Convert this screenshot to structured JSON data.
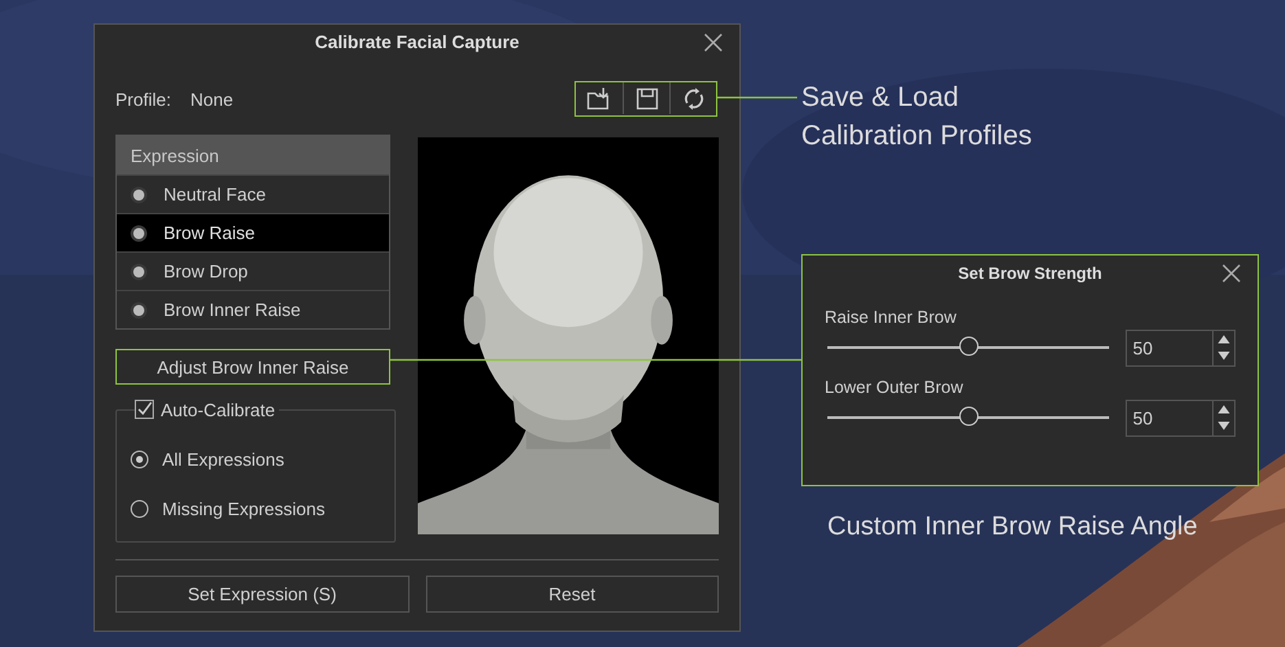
{
  "dialog": {
    "title": "Calibrate Facial Capture",
    "profile_label": "Profile:",
    "profile_value": "None",
    "expression_list": {
      "header": "Expression",
      "items": [
        {
          "label": "Neutral Face",
          "selected": false
        },
        {
          "label": "Brow Raise",
          "selected": true
        },
        {
          "label": "Brow Drop",
          "selected": false
        },
        {
          "label": "Brow Inner Raise",
          "selected": false
        }
      ]
    },
    "adjust_button": "Adjust Brow Inner Raise",
    "auto_calibrate": {
      "label": "Auto-Calibrate",
      "checked": true,
      "options": [
        {
          "label": "All Expressions",
          "selected": true
        },
        {
          "label": "Missing Expressions",
          "selected": false
        }
      ]
    },
    "buttons": [
      "Set Expression (S)",
      "Reset"
    ]
  },
  "profile_callout": {
    "lines": [
      "Save & Load",
      "Calibration Profiles"
    ]
  },
  "brow_dialog": {
    "title": "Set Brow Strength",
    "sliders": [
      {
        "label": "Raise Inner Brow",
        "level": 0.5,
        "value": "50"
      },
      {
        "label": "Lower Outer Brow",
        "level": 0.5,
        "value": "50"
      }
    ]
  },
  "brow_callout": "Custom Inner Brow Raise Angle"
}
